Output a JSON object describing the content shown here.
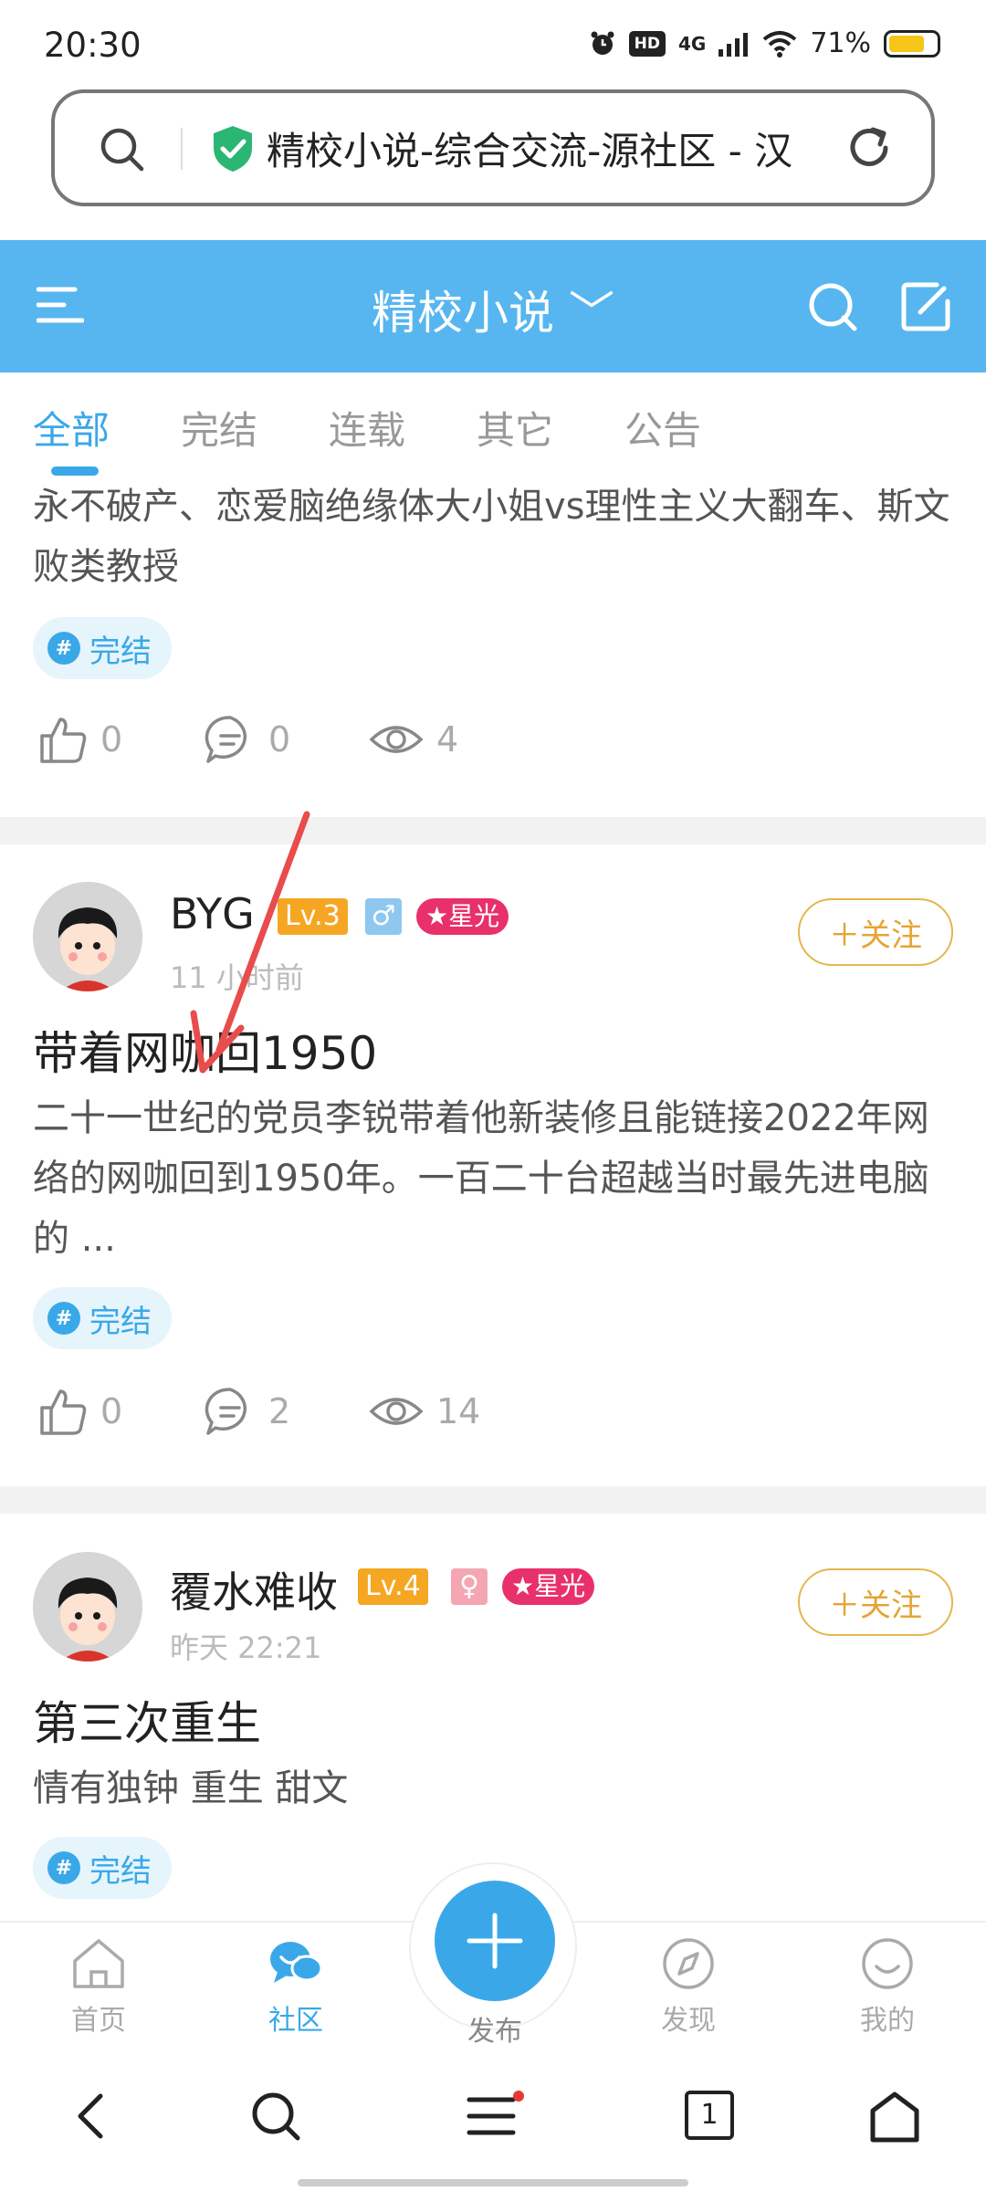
{
  "status_bar": {
    "time": "20:30",
    "network": "4G",
    "hd": "HD",
    "battery": "71%"
  },
  "url_bar": {
    "text": "精校小说-综合交流-源社区 - 汉"
  },
  "header": {
    "title": "精校小说 ﹀"
  },
  "tabs": [
    {
      "label": "全部"
    },
    {
      "label": "完结"
    },
    {
      "label": "连载"
    },
    {
      "label": "其它"
    },
    {
      "label": "公告"
    }
  ],
  "posts": [
    {
      "description": "永不破产、恋爱脑绝缘体大小姐vs理性主义大翻车、斯文败类教授",
      "tag": "完结",
      "likes": "0",
      "comments": "0",
      "views": "4"
    },
    {
      "author": "BYG",
      "level": "Lv.3",
      "gender": "♂",
      "badge": "★星光",
      "time": "11 小时前",
      "follow": "＋关注",
      "title": "带着网咖回1950",
      "description": "二十一世纪的党员李锐带着他新装修且能链接2022年网络的网咖回到1950年。一百二十台超越当时最先进电脑的 ...",
      "tag": "完结",
      "likes": "0",
      "comments": "2",
      "views": "14"
    },
    {
      "author": "覆水难收",
      "level": "Lv.4",
      "gender": "♀",
      "badge": "★星光",
      "time": "昨天 22:21",
      "follow": "＋关注",
      "title": "第三次重生",
      "description": "情有独钟 重生 甜文",
      "tag": "完结"
    }
  ],
  "bottom_nav": [
    {
      "label": "首页",
      "icon": "home-icon"
    },
    {
      "label": "社区",
      "icon": "community-icon"
    },
    {
      "label": "发布",
      "icon": "plus-icon"
    },
    {
      "label": "发现",
      "icon": "compass-icon"
    },
    {
      "label": "我的",
      "icon": "smiley-icon"
    }
  ],
  "system_nav": {
    "tab_count": "1"
  },
  "colors": {
    "accent": "#3aa8e8",
    "header": "#57b6ef",
    "follow": "#e4a534",
    "level": "#f5a623",
    "badge": "#e8306a"
  }
}
